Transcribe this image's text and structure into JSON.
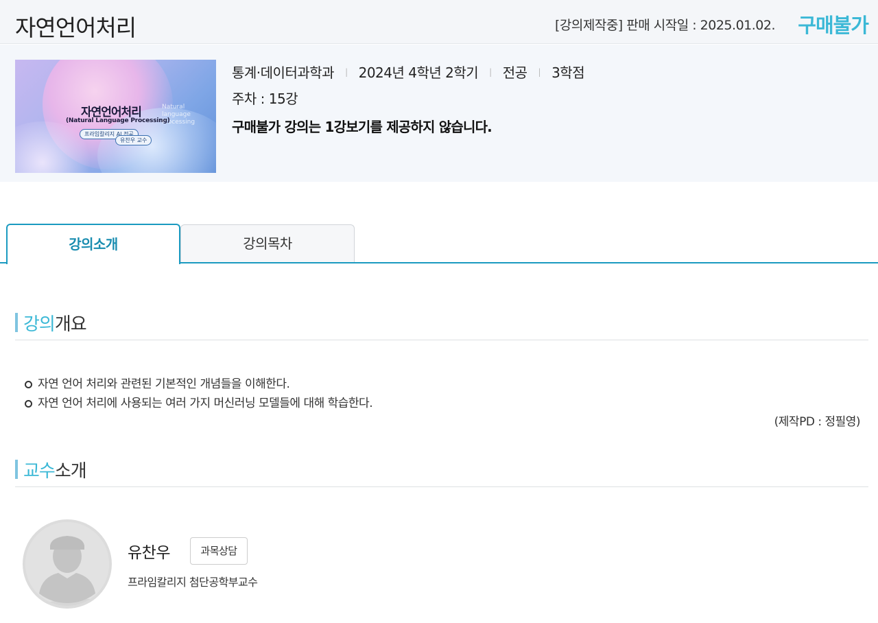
{
  "header": {
    "title": "자연언어처리",
    "status_text": "[강의제작중] 판매 시작일 : 2025.01.02.",
    "purchase_status": "구매불가"
  },
  "course_info": {
    "thumbnail": {
      "title": "자연언어처리",
      "subtitle": "(Natural Language Processing)",
      "badge_school": "프라임칼리지 AI 전공",
      "badge_professor": "유찬우 교수",
      "deco_text": "Natural language Processing"
    },
    "department": "통계·데이터과학과",
    "semester": "2024년  4학년 2학기",
    "category": "전공",
    "credits": "3학점",
    "weeks": "주차 : 15강",
    "notice": "구매불가 강의는 1강보기를 제공하지 않습니다."
  },
  "tabs": [
    {
      "label": "강의소개",
      "active": true
    },
    {
      "label": "강의목차",
      "active": false
    }
  ],
  "overview": {
    "heading_highlight": "강의",
    "heading_rest": "개요",
    "items": [
      "자연 언어 처리와 관련된 기본적인 개념들을 이해한다.",
      "자연 언어 처리에 사용되는 여러 가지 머신러닝 모델들에 대해 학습한다."
    ],
    "pd_credit": "(제작PD : 정필영)"
  },
  "professor": {
    "heading_highlight": "교수",
    "heading_rest": "소개",
    "name": "유찬우",
    "consult_label": "과목상담",
    "title": "프라임칼리지 첨단공학부교수"
  },
  "colors": {
    "accent": "#3bb8d6",
    "tab_border": "#1a9ac0"
  }
}
